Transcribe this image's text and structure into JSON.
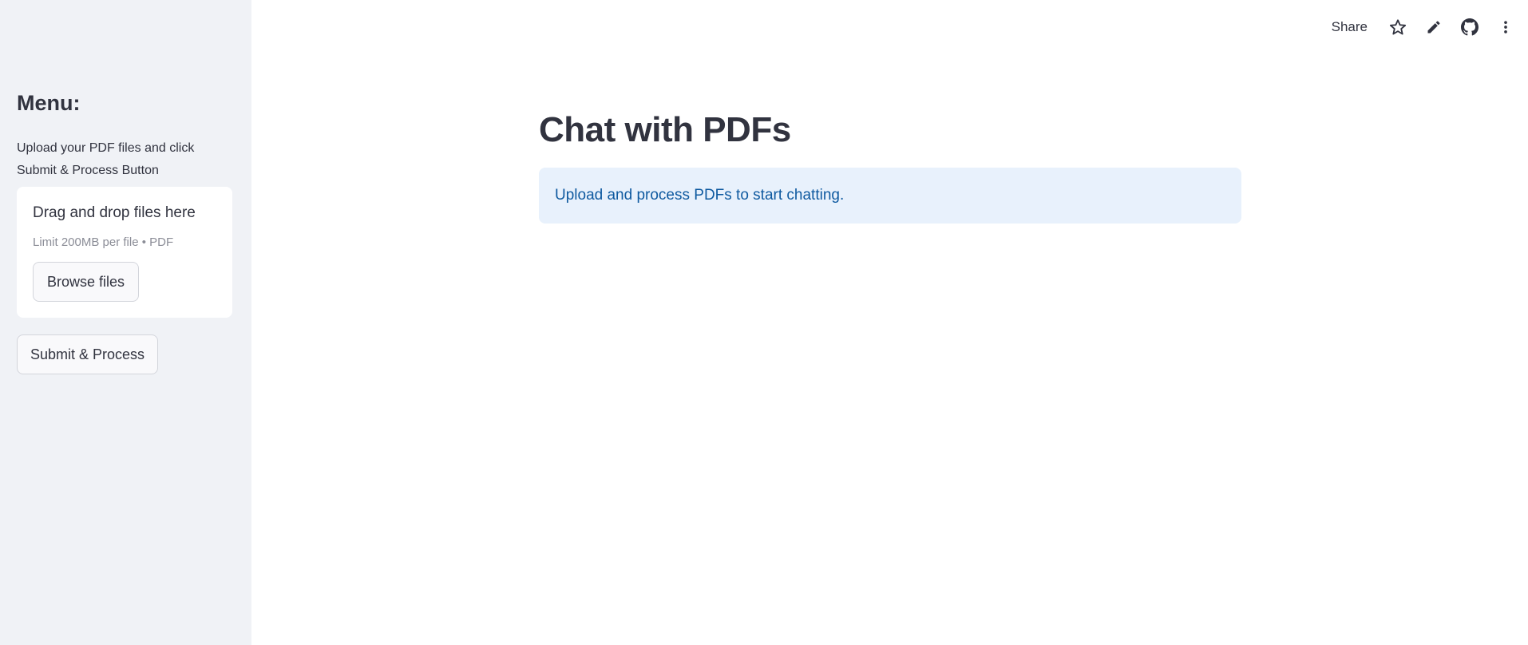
{
  "sidebar": {
    "menu_title": "Menu:",
    "description": "Upload your PDF files and click Submit & Process Button",
    "uploader": {
      "title": "Drag and drop files here",
      "limit": "Limit 200MB per file • PDF",
      "browse_label": "Browse files"
    },
    "submit_label": "Submit & Process"
  },
  "toolbar": {
    "share_label": "Share",
    "icons": [
      "star-icon",
      "pencil-icon",
      "github-icon",
      "more-vertical-icon"
    ]
  },
  "main": {
    "title": "Chat with PDFs",
    "info_message": "Upload and process PDFs to start chatting."
  },
  "colors": {
    "sidebar_bg": "#f0f2f6",
    "info_bg": "#e8f1fc",
    "info_text": "#0f5aa0",
    "text": "#31333f"
  }
}
